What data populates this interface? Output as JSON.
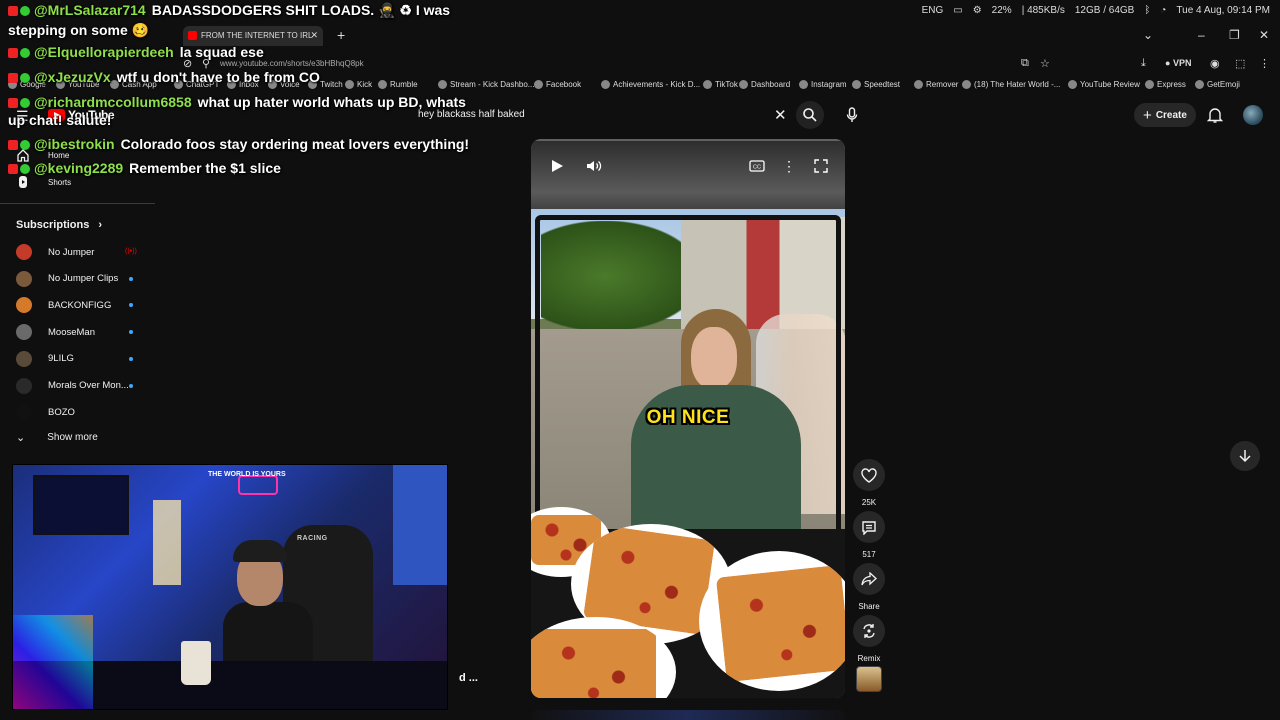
{
  "system": {
    "lang": "ENG",
    "battery": "22%",
    "net": "| 485KB/s",
    "memory": "12GB / 64GB",
    "datetime": "Tue 4 Aug, 09:14 PM"
  },
  "browser": {
    "tab_title": "FROM THE INTERNET TO IRL",
    "url": "www.youtube.com/shorts/e3bHBhqQ8pk",
    "vpn_label": "VPN",
    "bookmarks": [
      "Google",
      "YouTube",
      "Cash App",
      "ChatGPT",
      "Inbox",
      "Voice",
      "Twitch",
      "Kick",
      "Rumble",
      "Stream - Kick Dashbo...",
      "Facebook",
      "Achievements - Kick D...",
      "TikTok",
      "Dashboard",
      "Instagram",
      "Speedtest",
      "Remover",
      "(18) The Hater World -...",
      "YouTube Review",
      "Express",
      "GetEmoji"
    ]
  },
  "youtube": {
    "logo": "YouTube",
    "search_query": "hey blackass half baked",
    "create_label": "Create",
    "sidebar": {
      "home": "Home",
      "shorts": "Shorts",
      "subscriptions_title": "Subscriptions",
      "subscriptions": [
        {
          "name": "No Jumper",
          "color": "#c43b2a"
        },
        {
          "name": "No Jumper Clips",
          "color": "#7a5a3a"
        },
        {
          "name": "BACKONFIGG",
          "color": "#d47a2a"
        },
        {
          "name": "MooseMan",
          "color": "#6a6a6a"
        },
        {
          "name": "9LILG",
          "color": "#5a4a3a"
        },
        {
          "name": "Morals Over Mon...",
          "color": "#2a2a2a"
        },
        {
          "name": "BOZO",
          "color": "#111111"
        }
      ],
      "show_more": "Show more"
    },
    "short": {
      "caption": "OH NICE",
      "likes": "25K",
      "comments": "517",
      "share_label": "Share",
      "remix_label": "Remix"
    }
  },
  "chat": [
    {
      "user": "@MrLSalazar714",
      "msg": "BADASSDODGERS SHIT LOADS. 🥷 ♻ I was"
    },
    {
      "user": "",
      "msg": "stepping on some 🥴"
    },
    {
      "user": "@Elquellorapierdeeh",
      "msg": "la squad ese"
    },
    {
      "user": "@xJezuzVx",
      "msg": "wtf u don't have to be from CO"
    },
    {
      "user": "@richardmccollum6858",
      "msg": "what up hater world whats up BD, whats"
    },
    {
      "user": "",
      "msg": "up chat! salute!"
    },
    {
      "user": "@ibestrokin",
      "msg": "Colorado foos stay ordering meat lovers everything!"
    },
    {
      "user": "@keving2289",
      "msg": "Remember the $1 slice"
    }
  ],
  "webcam": {
    "sign_text": "THE WORLD IS YOURS",
    "chair_text": "RACING"
  },
  "overlay_ellipsis": "d ..."
}
